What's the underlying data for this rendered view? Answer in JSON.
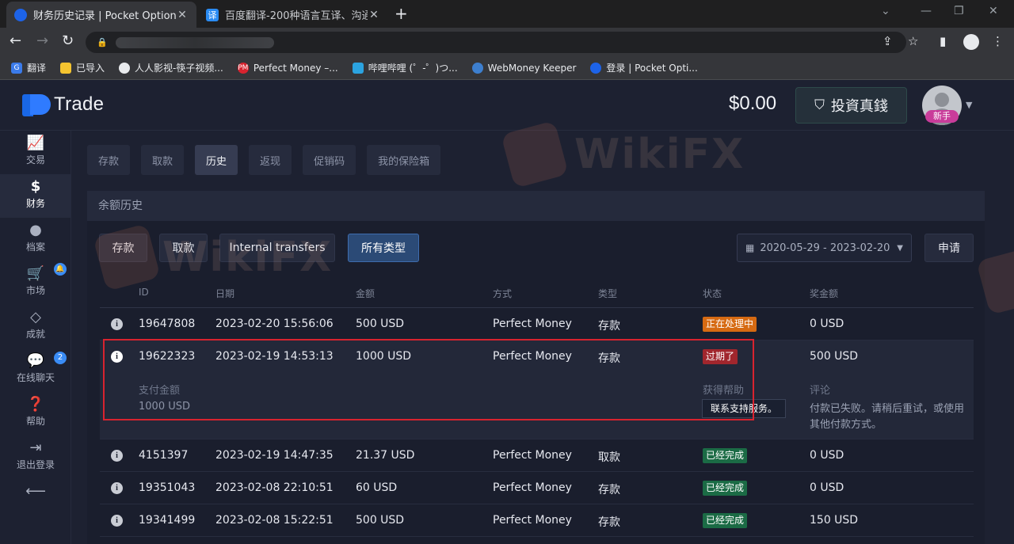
{
  "browser": {
    "tabs": [
      {
        "title": "财务历史记录 | Pocket Option",
        "active": true
      },
      {
        "title": "百度翻译-200种语言互译、沟通",
        "active": false
      }
    ],
    "bookmarks": [
      "翻译",
      "已导入",
      "人人影视-筷子视频...",
      "Perfect Money –...",
      "哔哩哔哩 (゜-゜)つ...",
      "WebMoney Keeper",
      "登录 | Pocket Opti..."
    ]
  },
  "header": {
    "logo_text": "Trade",
    "balance": "$0.00",
    "real_button": "投資真錢",
    "user_badge": "新手"
  },
  "sidebar": {
    "items": [
      {
        "label": "交易",
        "icon": "chart-icon"
      },
      {
        "label": "财务",
        "icon": "dollar-icon"
      },
      {
        "label": "档案",
        "icon": "user-icon"
      },
      {
        "label": "市场",
        "icon": "cart-icon"
      },
      {
        "label": "成就",
        "icon": "diamond-icon"
      },
      {
        "label": "在线聊天",
        "icon": "chat-icon",
        "badge": "2"
      },
      {
        "label": "帮助",
        "icon": "help-icon"
      },
      {
        "label": "退出登录",
        "icon": "logout-icon"
      }
    ]
  },
  "subnav": [
    "存款",
    "取款",
    "历史",
    "返现",
    "促销码",
    "我的保险箱"
  ],
  "panel": {
    "title": "余额历史",
    "filters": [
      "存款",
      "取款",
      "Internal transfers",
      "所有类型"
    ],
    "date_range": "2020-05-29 - 2023-02-20",
    "apply": "申请"
  },
  "table": {
    "columns": [
      "ID",
      "日期",
      "金额",
      "方式",
      "类型",
      "状态",
      "奖金额"
    ],
    "rows": [
      {
        "id": "19647808",
        "date": "2023-02-20 15:56:06",
        "amount": "500 USD",
        "method": "Perfect Money",
        "type": "存款",
        "status": "正在处理中",
        "bonus": "0 USD"
      },
      {
        "id": "19622323",
        "date": "2023-02-19 14:53:13",
        "amount": "1000 USD",
        "method": "Perfect Money",
        "type": "存款",
        "status": "过期了",
        "bonus": "500 USD"
      },
      {
        "id": "4151397",
        "date": "2023-02-19 14:47:35",
        "amount": "21.37 USD",
        "method": "Perfect Money",
        "type": "取款",
        "status": "已经完成",
        "bonus": "0 USD"
      },
      {
        "id": "19351043",
        "date": "2023-02-08 22:10:51",
        "amount": "60 USD",
        "method": "Perfect Money",
        "type": "存款",
        "status": "已经完成",
        "bonus": "0 USD"
      },
      {
        "id": "19341499",
        "date": "2023-02-08 15:22:51",
        "amount": "500 USD",
        "method": "Perfect Money",
        "type": "存款",
        "status": "已经完成",
        "bonus": "150 USD"
      }
    ],
    "detail": {
      "paid_label": "支付金额",
      "paid_value": "1000 USD",
      "help_label": "获得帮助",
      "support_button": "联系支持服务。",
      "comment_label": "评论",
      "comment_text": "付款已失败。请稍后重试，或使用其他付款方式。"
    }
  },
  "watermark": "WikiFX",
  "colors": {
    "accent": "#2f7bff",
    "processing": "#d66a12",
    "expired": "#a1262d",
    "done": "#1b6b45",
    "highlight": "#d8232f"
  }
}
